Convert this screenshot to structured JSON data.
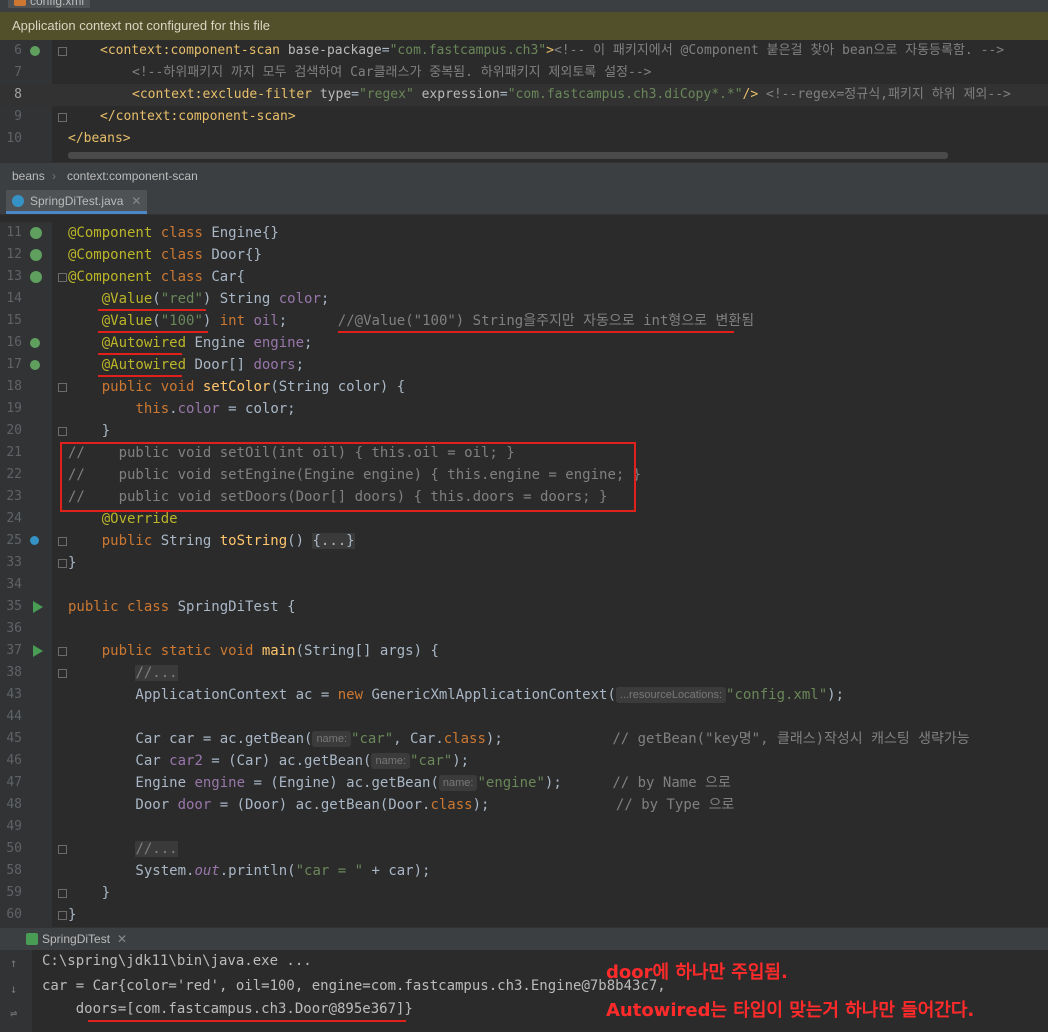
{
  "top_tab": {
    "label": "config.xml"
  },
  "banner": {
    "text": "Application context not configured for this file"
  },
  "xml_lines": [
    {
      "num": "6"
    },
    {
      "num": "7"
    },
    {
      "num": "8"
    },
    {
      "num": "9"
    },
    {
      "num": "10"
    }
  ],
  "breadcrumb": {
    "items": [
      "beans",
      "context:component-scan"
    ]
  },
  "editor_tab": {
    "label": "SpringDiTest.java"
  },
  "java_line_numbers": [
    "11",
    "12",
    "13",
    "14",
    "15",
    "16",
    "17",
    "18",
    "19",
    "20",
    "21",
    "22",
    "23",
    "23",
    "24",
    "25",
    "33",
    "34",
    "35",
    "36",
    "37",
    "38",
    "43",
    "44",
    "45",
    "46",
    "47",
    "48",
    "49",
    "50",
    "58",
    "59",
    "60"
  ],
  "hints": {
    "resourceLocations": "...resourceLocations:",
    "name": "name:"
  },
  "run_panel": {
    "tab_label": "SpringDiTest"
  },
  "console": {
    "line1": "C:\\spring\\jdk11\\bin\\java.exe ...",
    "line2": "car = Car{color='red', oil=100, engine=com.fastcampus.ch3.Engine@7b8b43c7,",
    "line3": "    doors=[com.fastcampus.ch3.Door@895e367]}"
  },
  "annotations": {
    "note1": "door에 하나만 주입됨.",
    "note2": "Autowired는 타입이 맞는거 하나만 들어간다."
  },
  "colors": {
    "accent_red": "#e0201a",
    "keyword": "#cc7832",
    "annotation": "#bbb529",
    "string": "#6a8759"
  }
}
